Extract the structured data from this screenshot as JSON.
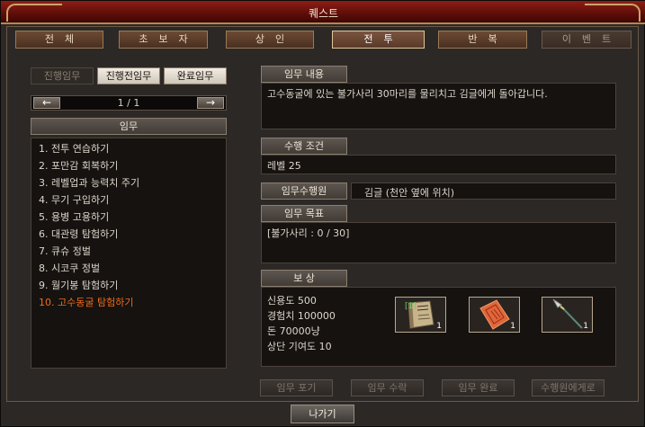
{
  "window": {
    "title": "퀘스트"
  },
  "tabs": [
    {
      "label": "전체"
    },
    {
      "label": "초보자"
    },
    {
      "label": "상인"
    },
    {
      "label": "전투"
    },
    {
      "label": "반복"
    },
    {
      "label": "이벤트"
    }
  ],
  "active_tab": "전투",
  "subtabs": [
    {
      "label": "진행임무"
    },
    {
      "label": "진행전임무"
    },
    {
      "label": "완료임무"
    }
  ],
  "pager": {
    "text": "1 / 1",
    "prev_icon": "arrow-left-icon",
    "next_icon": "arrow-right-icon"
  },
  "quest_list": {
    "header": "임무",
    "items": [
      "1. 전투 연습하기",
      "2. 포만감 회복하기",
      "3. 레벨업과 능력치 주기",
      "4. 무기 구입하기",
      "5. 용병 고용하기",
      "6. 대관령 탐험하기",
      "7. 큐슈 정벌",
      "8. 시코쿠 정벌",
      "9. 월기봉 탐험하기",
      "10. 고수동굴 탐험하기"
    ],
    "selected_index": 9
  },
  "detail": {
    "description_header": "임무 내용",
    "description": "고수동굴에 있는 불가사리 30마리를 물리치고 김글에게 돌아갑니다.",
    "condition_header": "수행 조건",
    "condition": "레벨 25",
    "giver_label": "임무수행원",
    "giver": "김글 (천안 옆에 위치)",
    "goal_header": "임무 목표",
    "goal": "[불가사리 : 0 / 30]",
    "reward_header": "보  상",
    "rewards": [
      "신용도 500",
      "경험치 100000",
      "돈 70000냥",
      "상단 기여도 10"
    ],
    "reward_items": [
      {
        "name": "book-icon",
        "qty": "1",
        "tag": "[1]"
      },
      {
        "name": "scroll-icon",
        "qty": "1"
      },
      {
        "name": "spear-icon",
        "qty": "1"
      }
    ]
  },
  "actions": {
    "abandon": "임무 포기",
    "accept": "임무 수락",
    "complete": "임무 완료",
    "to_giver": "수행원에게로"
  },
  "exit_label": "나가기"
}
